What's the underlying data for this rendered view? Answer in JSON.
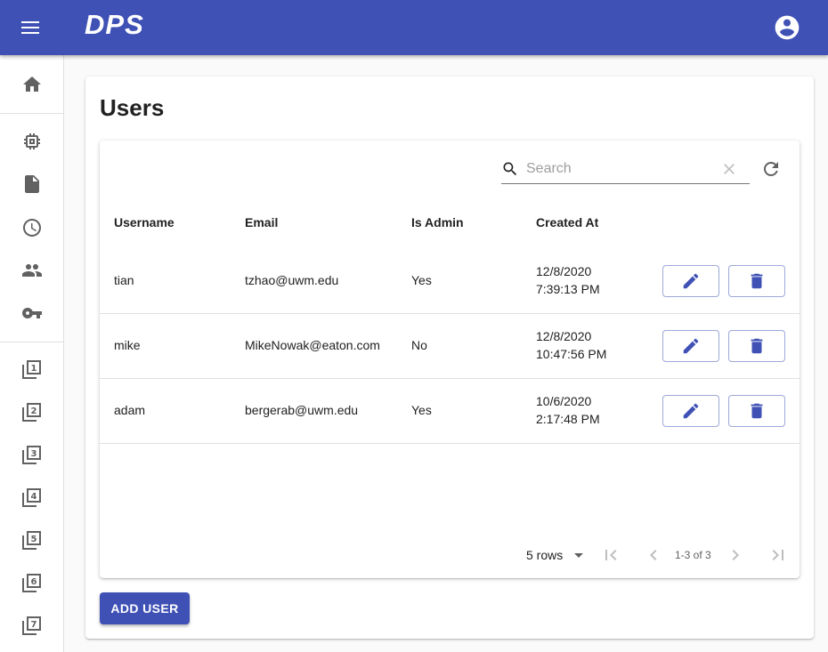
{
  "app": {
    "title": "DPS"
  },
  "sidebar": {
    "items": [
      {
        "icon": "home-icon"
      },
      {
        "icon": "chip-icon"
      },
      {
        "icon": "file-icon"
      },
      {
        "icon": "clock-icon"
      },
      {
        "icon": "people-icon"
      },
      {
        "icon": "key-icon"
      },
      {
        "icon": "filter-1-icon",
        "number": "1"
      },
      {
        "icon": "filter-2-icon",
        "number": "2"
      },
      {
        "icon": "filter-3-icon",
        "number": "3"
      },
      {
        "icon": "filter-4-icon",
        "number": "4"
      },
      {
        "icon": "filter-5-icon",
        "number": "5"
      },
      {
        "icon": "filter-6-icon",
        "number": "6"
      },
      {
        "icon": "filter-7-icon",
        "number": "7"
      }
    ]
  },
  "page": {
    "title": "Users"
  },
  "search": {
    "placeholder": "Search",
    "value": ""
  },
  "table": {
    "columns": [
      "Username",
      "Email",
      "Is Admin",
      "Created At"
    ],
    "rows": [
      {
        "username": "tian",
        "email": "tzhao@uwm.edu",
        "is_admin": "Yes",
        "created_date": "12/8/2020",
        "created_time": "7:39:13 PM"
      },
      {
        "username": "mike",
        "email": "MikeNowak@eaton.com",
        "is_admin": "No",
        "created_date": "12/8/2020",
        "created_time": "10:47:56 PM"
      },
      {
        "username": "adam",
        "email": "bergerab@uwm.edu",
        "is_admin": "Yes",
        "created_date": "10/6/2020",
        "created_time": "2:17:48 PM"
      }
    ]
  },
  "pagination": {
    "rows_label": "5 rows",
    "range_label": "1-3 of 3"
  },
  "actions": {
    "add_user_label": "ADD USER"
  },
  "colors": {
    "primary": "#3f51b5",
    "icon_grey": "#616161"
  }
}
